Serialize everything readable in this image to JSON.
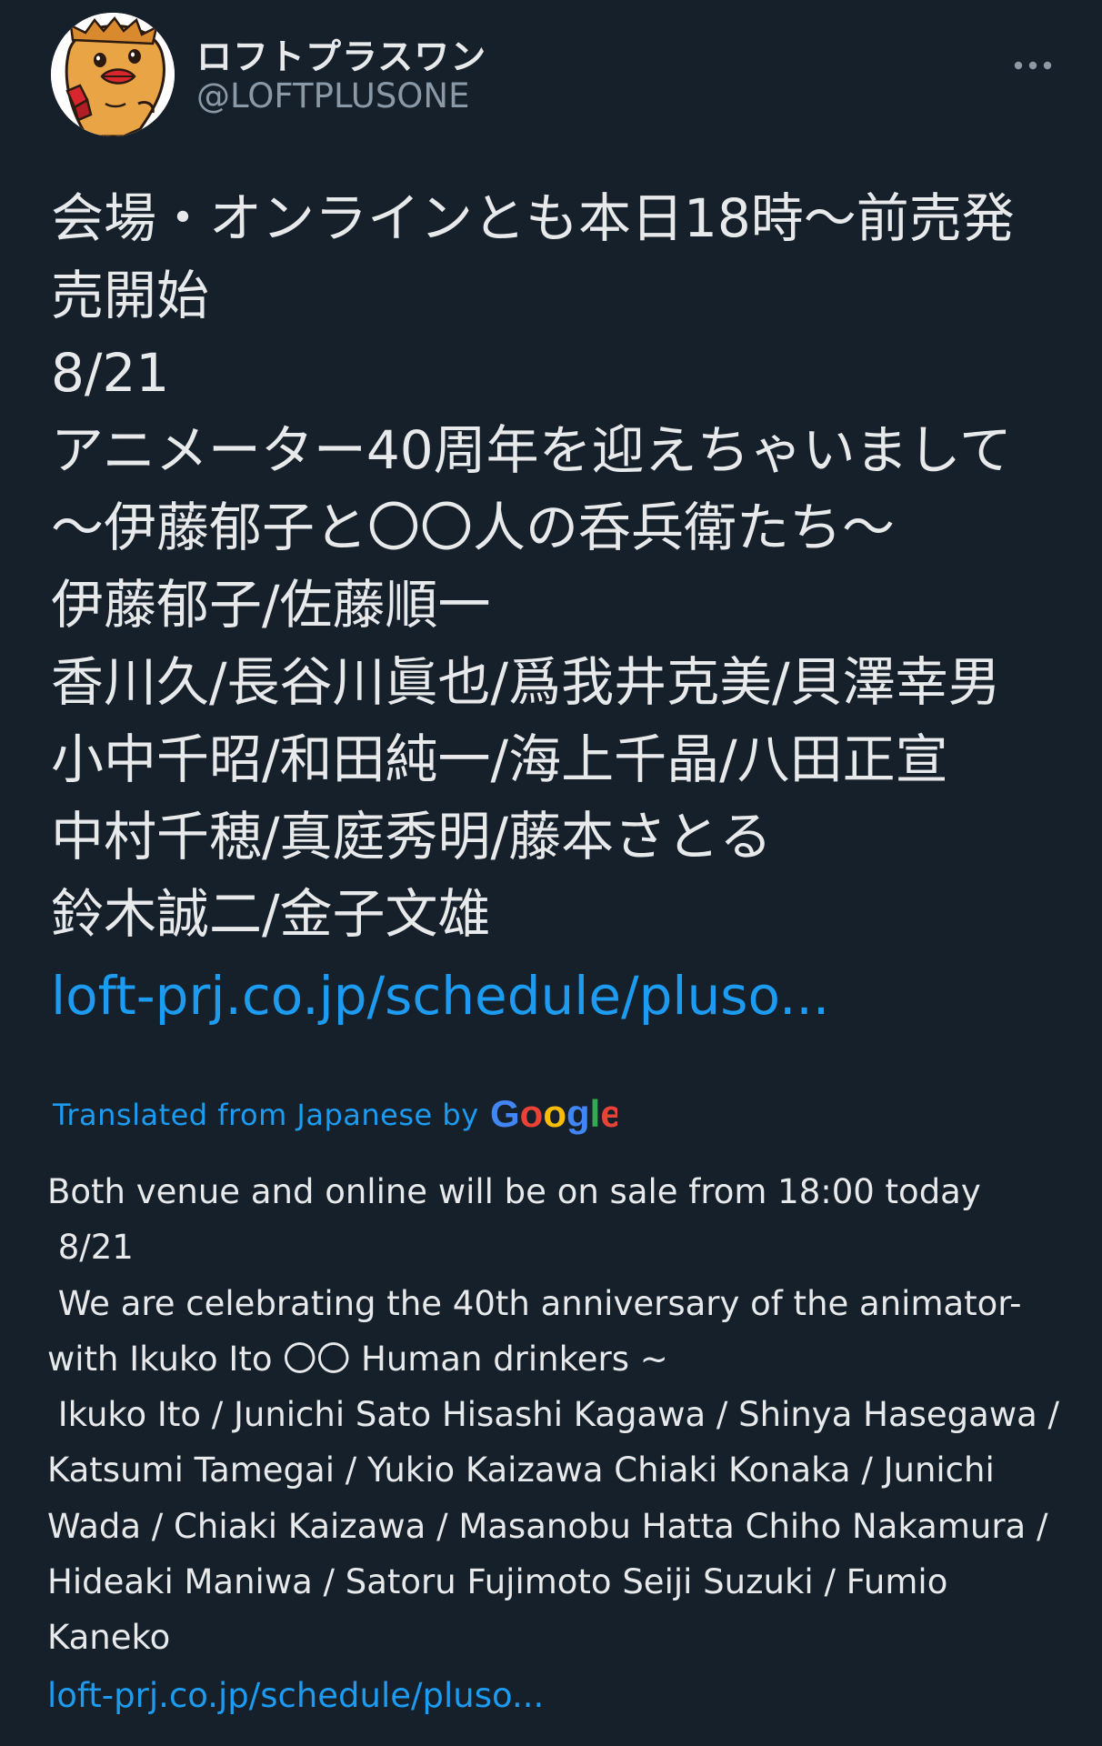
{
  "user": {
    "name": "ロフトプラスワン",
    "handle": "@LOFTPLUSONE"
  },
  "tweet": {
    "lines": [
      "会場・オンラインとも本日18時～前売発",
      "売開始",
      "8/21",
      "アニメーター40周年を迎えちゃいまして",
      "～伊藤郁子と〇〇人の呑兵衛たち～",
      "伊藤郁子/佐藤順一",
      "香川久/長谷川眞也/爲我井克美/貝澤幸男",
      "小中千昭/和田純一/海上千晶/八田正宣",
      "中村千穂/真庭秀明/藤本さとる",
      "鈴木誠二/金子文雄"
    ],
    "link": "loft-prj.co.jp/schedule/pluso..."
  },
  "translation": {
    "label": "Translated from Japanese by",
    "provider": "Google",
    "lines": [
      "Both venue and online will be on sale from 18:00 today",
      " 8/21",
      " We are celebrating the 40th anniversary of the animator-",
      "with Ikuko Ito 〇〇 Human drinkers ~",
      " Ikuko Ito / Junichi Sato Hisashi Kagawa / Shinya Hasegawa /",
      "Katsumi Tamegai / Yukio Kaizawa Chiaki Konaka / Junichi",
      "Wada / Chiaki Kaizawa / Masanobu Hatta Chiho Nakamura /",
      "Hideaki Maniwa / Satoru Fujimoto Seiji Suzuki / Fumio",
      "Kaneko"
    ],
    "link": "loft-prj.co.jp/schedule/pluso..."
  },
  "colors": {
    "background": "#15202b",
    "text": "#e7e9ea",
    "secondary": "#8b98a5",
    "link": "#1d9bf0"
  },
  "icons": {
    "more": "more-horizontal-icon",
    "avatar": "mascot-avatar"
  }
}
